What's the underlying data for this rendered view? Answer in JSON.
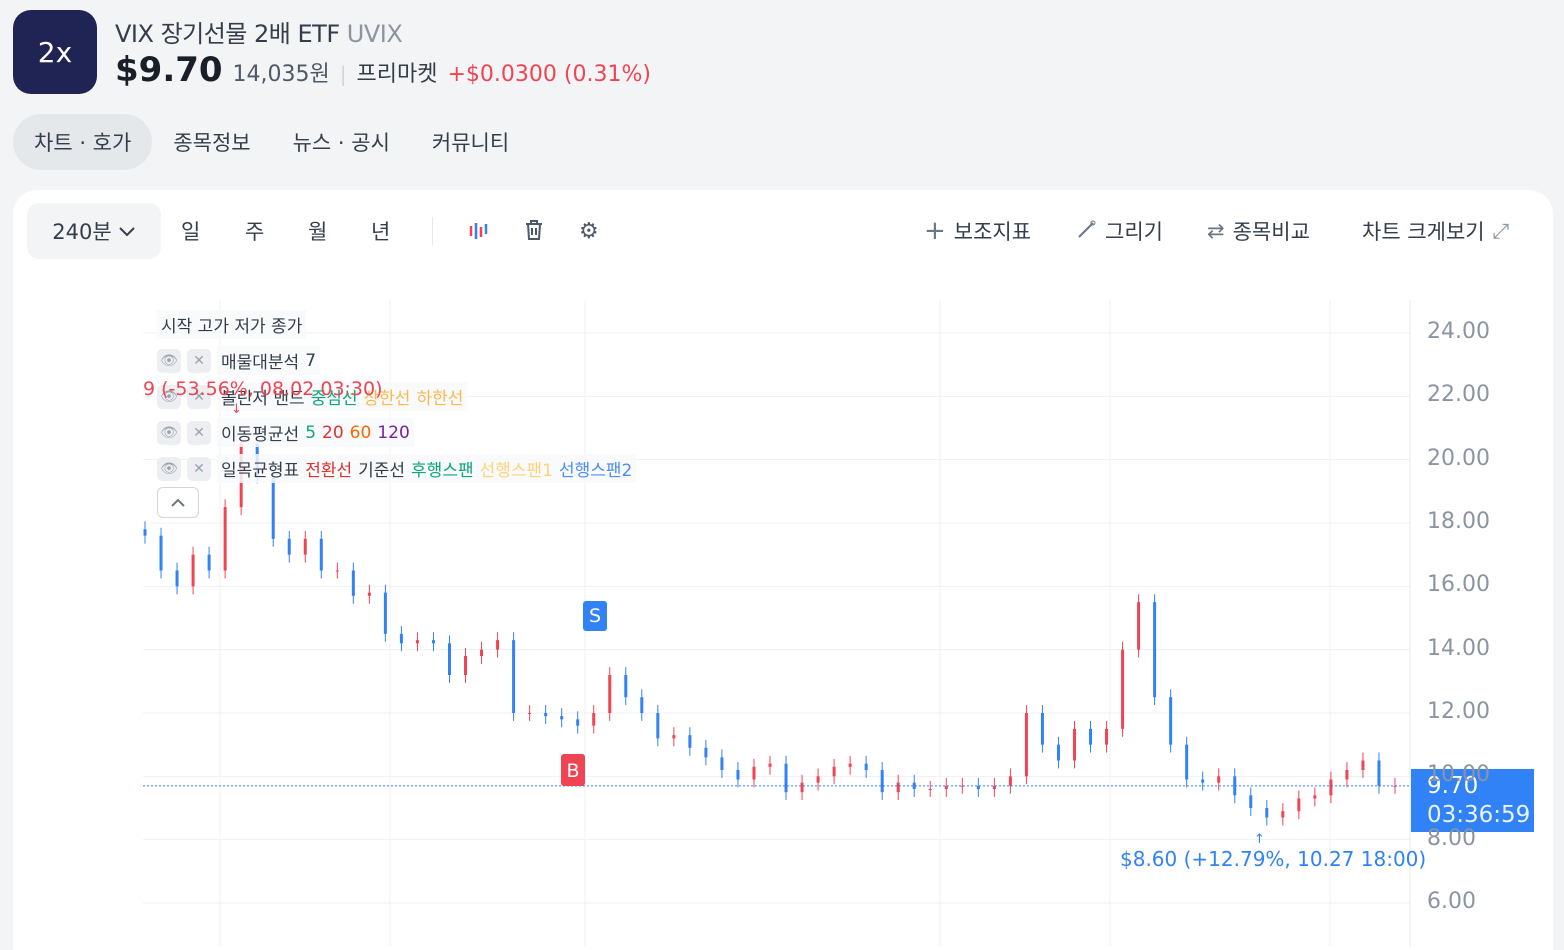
{
  "header": {
    "logo_text": "2x",
    "name": "VIX 장기선물 2배 ETF",
    "ticker": "UVIX",
    "price": "$9.70",
    "price_krw": "14,035원",
    "market": "프리마켓",
    "change": "+$0.0300 (0.31%)"
  },
  "tabs": [
    {
      "label": "차트 · 호가",
      "active": true
    },
    {
      "label": "종목정보"
    },
    {
      "label": "뉴스 · 공시"
    },
    {
      "label": "커뮤니티"
    }
  ],
  "toolbar": {
    "period": "240분",
    "periods": [
      "일",
      "주",
      "월",
      "년"
    ],
    "icons": [
      "candle-chart-icon",
      "trash-icon",
      "gear-icon"
    ],
    "right": [
      {
        "label": "보조지표",
        "icon": "plus-icon"
      },
      {
        "label": "그리기",
        "icon": "pen-icon"
      },
      {
        "label": "종목비교",
        "icon": "swap-icon"
      },
      {
        "label": "차트 크게보기",
        "icon": "expand-icon"
      }
    ]
  },
  "legend": {
    "ohlc": "시작 고가 저가 종가",
    "rows": [
      {
        "name": "매물대분석",
        "parts": [
          {
            "t": "7",
            "c": "#333d4b"
          }
        ]
      },
      {
        "name": "볼린저 밴드",
        "parts": [
          {
            "t": "중심선",
            "c": "#0ca678"
          },
          {
            "t": "상한선",
            "c": "#ffb74d"
          },
          {
            "t": "하한선",
            "c": "#ffb74d"
          }
        ]
      },
      {
        "name": "이동평균선",
        "parts": [
          {
            "t": "5",
            "c": "#0ca678"
          },
          {
            "t": "20",
            "c": "#e03131"
          },
          {
            "t": "60",
            "c": "#f76707"
          },
          {
            "t": "120",
            "c": "#7b1fa2"
          }
        ]
      },
      {
        "name": "일목균형표",
        "parts": [
          {
            "t": "전환선",
            "c": "#e03131"
          },
          {
            "t": "기준선",
            "c": "#333d4b"
          },
          {
            "t": "후행스팬",
            "c": "#0ca678"
          },
          {
            "t": "선행스팬1",
            "c": "#ffd27a"
          },
          {
            "t": "선행스팬2",
            "c": "#4c8df6"
          }
        ]
      }
    ]
  },
  "chart_data": {
    "type": "candlestick",
    "y_ticks": [
      "24.00",
      "22.00",
      "20.00",
      "18.00",
      "16.00",
      "14.00",
      "12.00",
      "10.00",
      "8.00",
      "6.00"
    ],
    "ylim": [
      6,
      24
    ],
    "closes": [
      17.6,
      16.5,
      16.0,
      17.0,
      16.5,
      18.5,
      20.5,
      19.5,
      17.5,
      17.0,
      17.5,
      16.5,
      16.5,
      15.7,
      15.8,
      14.5,
      14.2,
      14.3,
      14.2,
      13.2,
      13.8,
      14.0,
      14.3,
      12.0,
      12.0,
      11.9,
      11.8,
      11.6,
      12.0,
      13.2,
      12.5,
      12.0,
      11.2,
      11.3,
      10.9,
      10.6,
      10.2,
      9.9,
      10.3,
      10.4,
      9.5,
      9.8,
      10.0,
      10.3,
      10.4,
      10.2,
      9.5,
      9.8,
      9.6,
      9.6,
      9.7,
      9.7,
      9.6,
      9.7,
      10.0,
      12.0,
      11.0,
      10.5,
      11.5,
      11.0,
      11.5,
      14.0,
      15.5,
      12.5,
      11.0,
      9.9,
      9.8,
      10.0,
      9.4,
      9.0,
      8.7,
      8.9,
      9.3,
      9.4,
      9.9,
      10.2,
      10.5,
      9.7,
      9.7
    ],
    "up_color": "#f04452",
    "down_color": "#3182f6",
    "current": {
      "price": "9.70",
      "timer": "03:36:59"
    },
    "high_note": "9 (-53.56%, 08.02 03:30)",
    "low_note": "$8.60 (+12.79%, 10.27 18:00)",
    "markers": [
      {
        "label": "S",
        "color": "#3182f6"
      },
      {
        "label": "B",
        "color": "#f04452"
      }
    ]
  }
}
